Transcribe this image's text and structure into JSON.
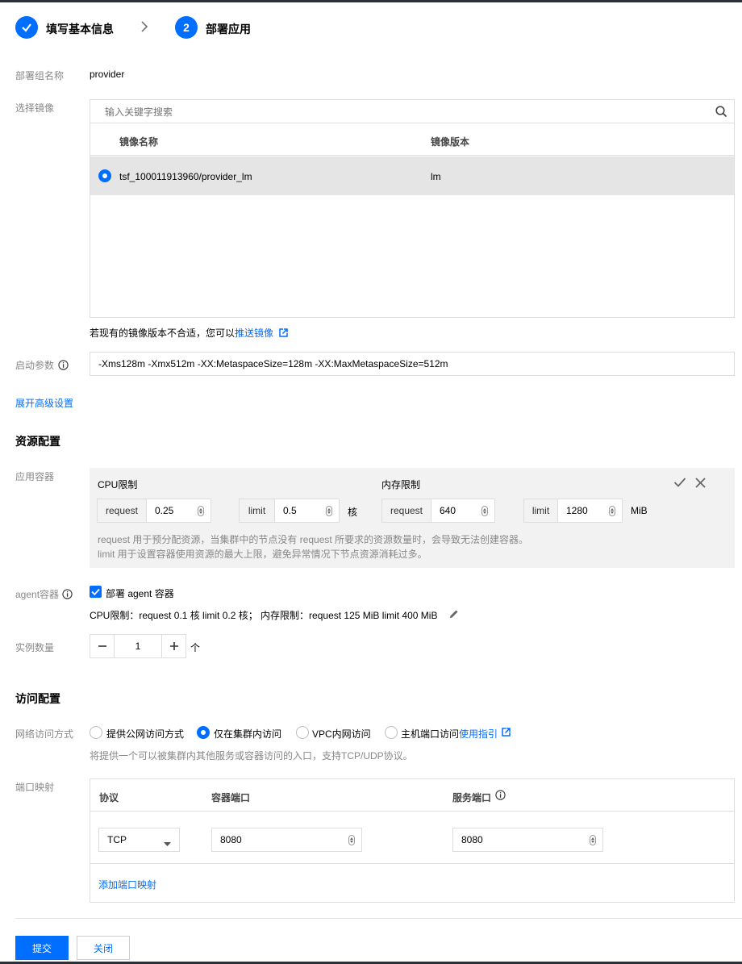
{
  "steps": [
    {
      "label": "填写基本信息",
      "state": "done"
    },
    {
      "number": "2",
      "label": "部署应用",
      "state": "active"
    }
  ],
  "form": {
    "deploy_group_label": "部署组名称",
    "deploy_group_value": "provider",
    "image_label": "选择镜像",
    "image_search_placeholder": "输入关键字搜索",
    "image_table": {
      "headers": [
        "镜像名称",
        "镜像版本"
      ],
      "rows": [
        {
          "name": "tsf_100011913960/provider_lm",
          "version": "lm",
          "selected": true
        }
      ]
    },
    "image_hint": "若现有的镜像版本不合适，您可以",
    "image_hint_link": "推送镜像",
    "startup_label": "启动参数",
    "startup_value": "-Xms128m -Xmx512m -XX:MetaspaceSize=128m -XX:MaxMetaspaceSize=512m",
    "advanced_link": "展开高级设置"
  },
  "resource": {
    "title": "资源配置",
    "app_container_label": "应用容器",
    "cpu_title": "CPU限制",
    "mem_title": "内存限制",
    "cpu_request_label": "request",
    "cpu_request_value": "0.25",
    "cpu_limit_label": "limit",
    "cpu_limit_value": "0.5",
    "cpu_unit": "核",
    "mem_request_label": "request",
    "mem_request_value": "640",
    "mem_limit_label": "limit",
    "mem_limit_value": "1280",
    "mem_unit": "MiB",
    "hint1": "request 用于预分配资源，当集群中的节点没有 request 所要求的资源数量时，会导致无法创建容器。",
    "hint2": "limit 用于设置容器使用资源的最大上限，避免异常情况下节点资源消耗过多。",
    "agent_label": "agent容器",
    "agent_checkbox_label": "部署 agent 容器",
    "agent_checked": true,
    "agent_summary": "CPU限制：request 0.1 核 limit 0.2 核；  内存限制：request 125 MiB limit 400 MiB",
    "instance_label": "实例数量",
    "instance_value": "1",
    "instance_unit": "个"
  },
  "access": {
    "title": "访问配置",
    "network_label": "网络访问方式",
    "options": [
      "提供公网访问方式",
      "仅在集群内访问",
      "VPC内网访问",
      "主机端口访问"
    ],
    "selected_option": "仅在集群内访问",
    "usage_link": "使用指引",
    "network_hint": "将提供一个可以被集群内其他服务或容器访问的入口，支持TCP/UDP协议。",
    "port_label": "端口映射",
    "port_headers": [
      "协议",
      "容器端口",
      "服务端口"
    ],
    "port_rows": [
      {
        "protocol": "TCP",
        "container_port": "8080",
        "service_port": "8080"
      }
    ],
    "add_port_link": "添加端口映射"
  },
  "footer": {
    "submit": "提交",
    "close": "关闭"
  },
  "colors": {
    "accent": "#006eff",
    "panel_bg": "#f2f2f2",
    "selected_row_bg": "#e5e5e5"
  }
}
